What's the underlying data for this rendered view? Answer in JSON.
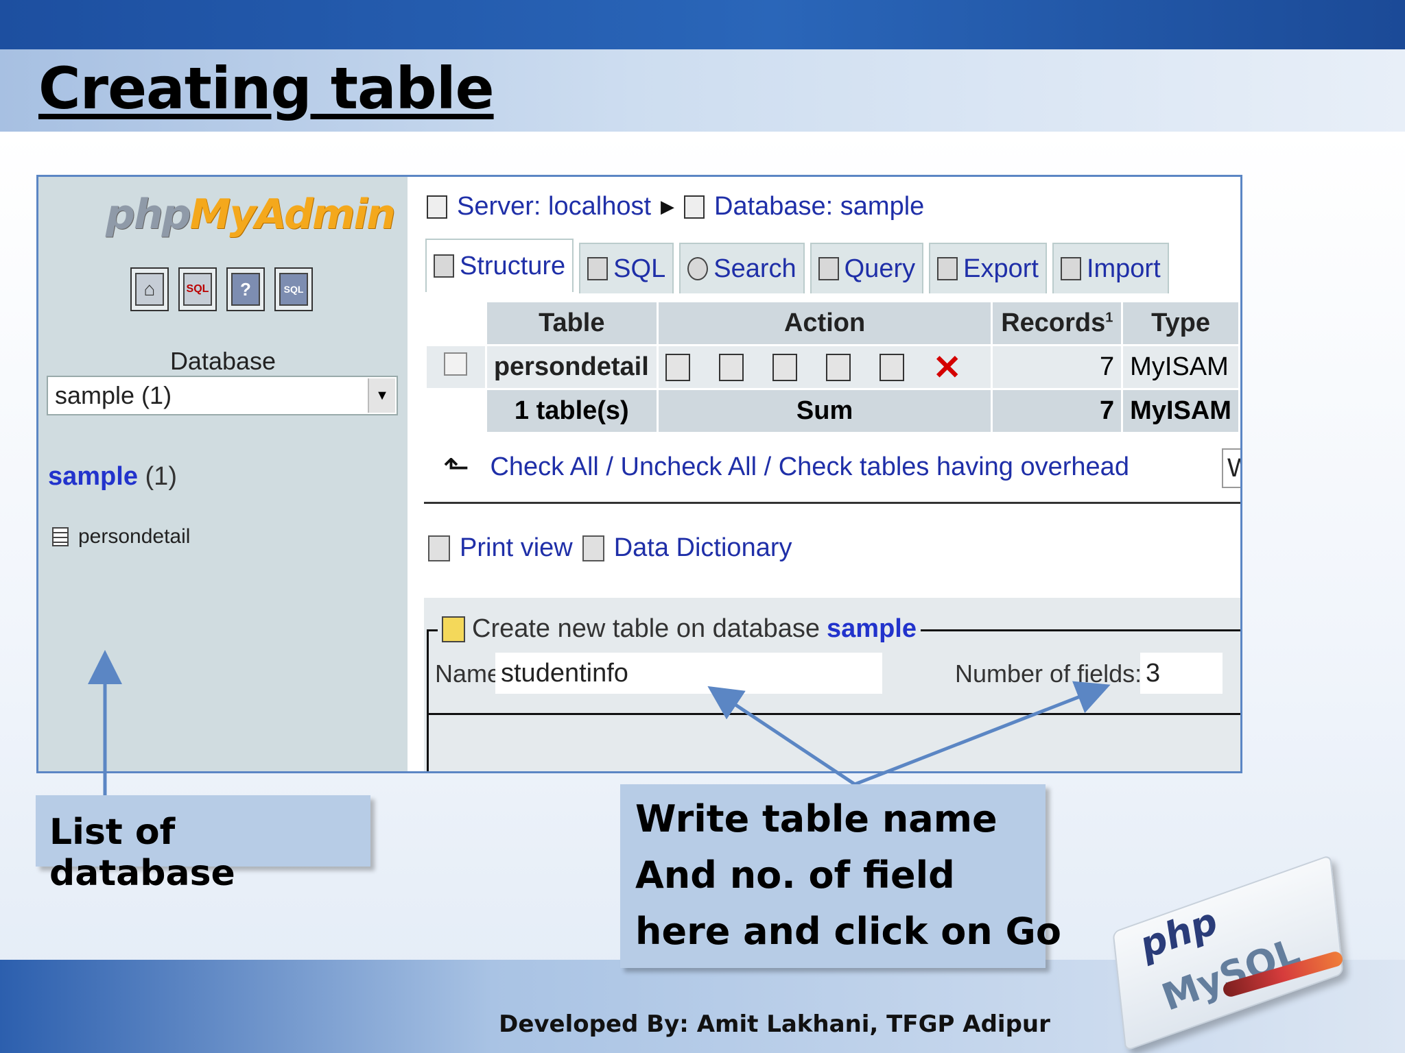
{
  "slide": {
    "title": "Creating table",
    "credit": "Developed By: Amit Lakhani, TFGP Adipur"
  },
  "left_panel": {
    "logo_php": "php",
    "logo_myadmin": "MyAdmin",
    "icons": [
      "home-icon",
      "sql-icon",
      "help-icon",
      "sql-query-icon"
    ],
    "icon_labels": [
      "",
      "SQL",
      "?",
      "SQL"
    ],
    "database_label": "Database",
    "database_select": "sample (1)",
    "tree_db_name": "sample",
    "tree_db_count": "(1)",
    "tree_table": "persondetail"
  },
  "breadcrumb": {
    "server": "Server: localhost",
    "database": "Database: sample"
  },
  "tabs": [
    "Structure",
    "SQL",
    "Search",
    "Query",
    "Export",
    "Import"
  ],
  "structure_table": {
    "headers": [
      "Table",
      "Action",
      "Records",
      "Type"
    ],
    "records_footnote": "1",
    "row": {
      "table": "persondetail",
      "actions": [
        "browse-icon",
        "structure-icon",
        "search-icon",
        "insert-icon",
        "empty-icon",
        "drop-icon"
      ],
      "records": "7",
      "type": "MyISAM"
    },
    "footer": {
      "table": "1 table(s)",
      "action": "Sum",
      "records": "7",
      "type": "MyISAM"
    }
  },
  "check_all": {
    "text": "Check All / Uncheck All / Check tables having overhead",
    "with_select": "With"
  },
  "links": {
    "print_view": "Print view",
    "data_dictionary": "Data Dictionary"
  },
  "create_table": {
    "legend_prefix": "Create new table on database",
    "legend_db": "sample",
    "name_label": "Name:",
    "name_value": "studentinfo",
    "fields_label": "Number of fields:",
    "fields_value": "3"
  },
  "annotations": {
    "list_of_database": "List of database",
    "write_lines": [
      "Write table name",
      "And no. of field",
      "here and click on Go"
    ]
  },
  "colors": {
    "link_blue": "#1f2fa8",
    "callout_bg": "#b7cce6",
    "arrow": "#5b86c4",
    "drop_red": "#d40000"
  },
  "corner_logo": {
    "php": "php",
    "mysql": "MySQL"
  }
}
